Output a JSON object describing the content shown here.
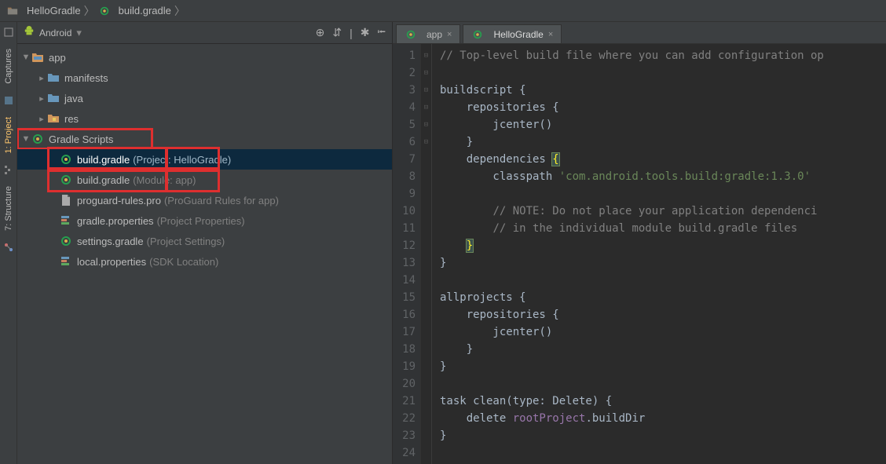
{
  "breadcrumbs": {
    "project": "HelloGradle",
    "file": "build.gradle"
  },
  "left_stripe": {
    "captures": "Captures",
    "project": "1: Project",
    "structure": "7: Structure"
  },
  "project_toolbar": {
    "view": "Android"
  },
  "tree": {
    "app": "app",
    "manifests": "manifests",
    "java": "java",
    "res": "res",
    "gradle_scripts": "Gradle Scripts",
    "build_gradle1": {
      "name": "build.gradle",
      "desc": "(Project: HelloGradle)"
    },
    "build_gradle2": {
      "name": "build.gradle",
      "desc": "(Module: app)"
    },
    "proguard": {
      "name": "proguard-rules.pro",
      "desc": "(ProGuard Rules for app)"
    },
    "gradle_props": {
      "name": "gradle.properties",
      "desc": "(Project Properties)"
    },
    "settings_gradle": {
      "name": "settings.gradle",
      "desc": "(Project Settings)"
    },
    "local_props": {
      "name": "local.properties",
      "desc": "(SDK Location)"
    }
  },
  "editor_tabs": {
    "tab1": "app",
    "tab2": "HelloGradle"
  },
  "code_lines": [
    {
      "n": 1,
      "html": "<span class=\"cm-comment\">// Top-level build file where you can add configuration op</span>"
    },
    {
      "n": 2,
      "html": ""
    },
    {
      "n": 3,
      "html": "<span class=\"cm-method\">buildscript</span> {"
    },
    {
      "n": 4,
      "html": "    repositories {"
    },
    {
      "n": 5,
      "html": "        jcenter()"
    },
    {
      "n": 6,
      "html": "    }"
    },
    {
      "n": 7,
      "html": "    dependencies <span class=\"brace-hl\">{</span>"
    },
    {
      "n": 8,
      "html": "        classpath <span class=\"cm-string\">'com.android.tools.build:gradle:1.3.0'</span>"
    },
    {
      "n": 9,
      "html": ""
    },
    {
      "n": 10,
      "html": "        <span class=\"cm-comment\">// NOTE: Do not place your application dependenci</span>"
    },
    {
      "n": 11,
      "html": "        <span class=\"cm-comment\">// in the individual module build.gradle files</span>"
    },
    {
      "n": 12,
      "html": "    <span class=\"brace-hl\">}</span>"
    },
    {
      "n": 13,
      "html": "}"
    },
    {
      "n": 14,
      "html": ""
    },
    {
      "n": 15,
      "html": "<span class=\"cm-method\">allprojects</span> {"
    },
    {
      "n": 16,
      "html": "    repositories {"
    },
    {
      "n": 17,
      "html": "        jcenter()"
    },
    {
      "n": 18,
      "html": "    }"
    },
    {
      "n": 19,
      "html": "}"
    },
    {
      "n": 20,
      "html": ""
    },
    {
      "n": 21,
      "html": "<span class=\"cm-method\">task</span> clean(type: Delete) {"
    },
    {
      "n": 22,
      "html": "    delete <span class=\"cm-prop\">rootProject</span>.buildDir"
    },
    {
      "n": 23,
      "html": "}"
    },
    {
      "n": 24,
      "html": ""
    }
  ]
}
